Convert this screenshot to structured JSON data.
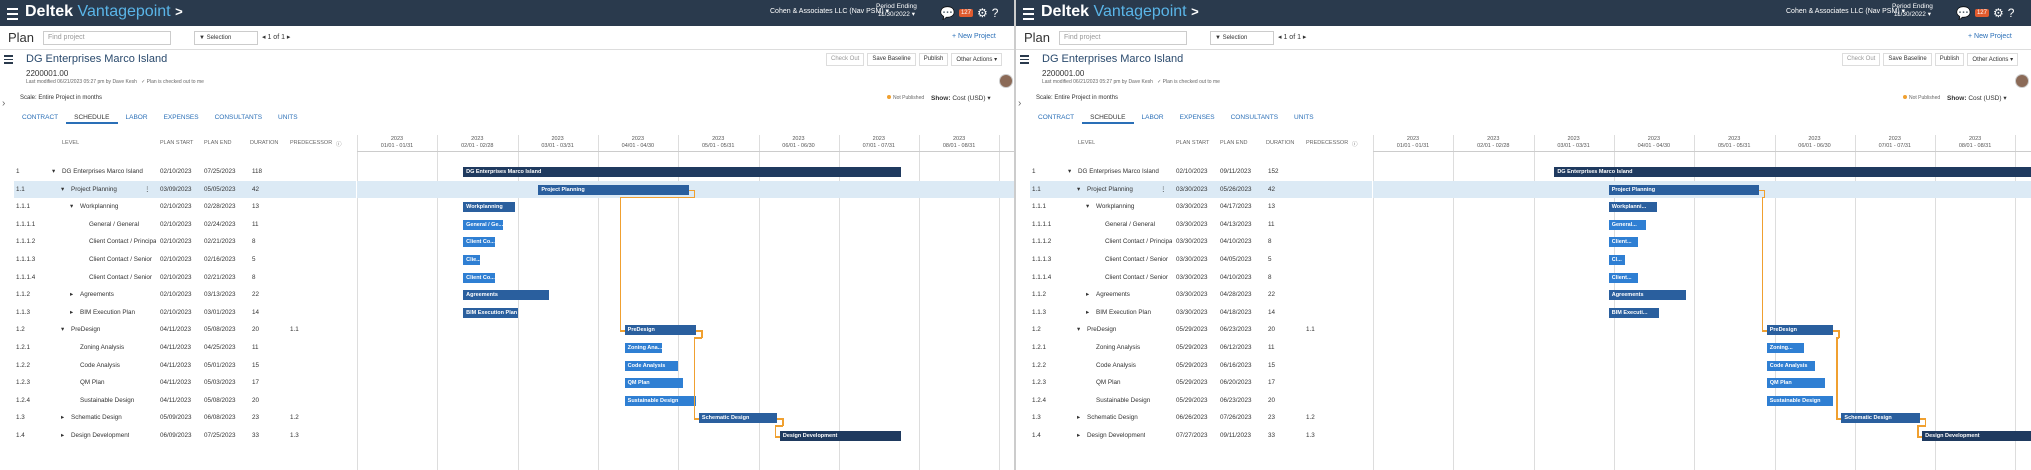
{
  "header": {
    "logo_main": "Deltek",
    "logo_sub": "Vantagepoint",
    "logo_arrow": ">",
    "company": "Cohen & Associates LLC (Nav PSM) ▾",
    "period_label": "Period Ending",
    "period_value": "11/30/2022 ▾",
    "notification_count": "127"
  },
  "toolbar": {
    "plan_label": "Plan",
    "find_placeholder": "Find project",
    "selection_label": "▼ Selection",
    "pager_text": "◂ 1 of 1 ▸",
    "new_project": "+ New Project"
  },
  "project": {
    "title": "DG Enterprises Marco Island",
    "number": "2200001.00",
    "last_modified": "Last modified 06/21/2023 05:27 pm by Dave Kesh",
    "checked_out": "✓ Plan is checked out to me",
    "actions": [
      "Check Out",
      "Save Baseline",
      "Publish",
      "Other Actions ▾"
    ]
  },
  "scale_text": "Scale: Entire Project in months",
  "not_published": "Not Published",
  "show_label": "Show:",
  "show_value": "Cost (USD) ▾",
  "tabs": [
    "CONTRACT",
    "SCHEDULE",
    "LABOR",
    "EXPENSES",
    "CONSULTANTS",
    "UNITS"
  ],
  "columns": [
    "LEVEL",
    "PLAN START",
    "PLAN END",
    "DURATION",
    "PREDECESSOR"
  ],
  "months": [
    [
      "2023",
      "01/01 - 01/31"
    ],
    [
      "2023",
      "02/01 - 02/28"
    ],
    [
      "2023",
      "03/01 - 03/31"
    ],
    [
      "2023",
      "04/01 - 04/30"
    ],
    [
      "2023",
      "05/01 - 05/31"
    ],
    [
      "2023",
      "06/01 - 06/30"
    ],
    [
      "2023",
      "07/01 - 07/31"
    ],
    [
      "2023",
      "08/01 - 08/31"
    ],
    [
      "2023",
      "09/01 - 09/30"
    ],
    [
      "2023",
      "10/01 - 10/31"
    ]
  ],
  "panes": [
    {
      "rows": [
        {
          "lvl": "1",
          "name": "DG Enterprises Marco Island",
          "depth": 0,
          "exp": "▾",
          "start": "02/10/2023",
          "end": "07/25/2023",
          "dur": "118",
          "pred": "",
          "bar": "DG Enterprises Marco Island",
          "bs": "2023-02-10",
          "be": "2023-07-25",
          "color": "dark"
        },
        {
          "lvl": "1.1",
          "name": "Project Planning",
          "depth": 1,
          "exp": "▾",
          "start": "03/09/2023",
          "end": "05/05/2023",
          "dur": "42",
          "pred": "",
          "bar": "Project Planning",
          "bs": "2023-03-09",
          "be": "2023-05-05",
          "color": "mid",
          "hl": true,
          "menu": "⋮"
        },
        {
          "lvl": "1.1.1",
          "name": "Workplanning",
          "depth": 2,
          "exp": "▾",
          "start": "02/10/2023",
          "end": "02/28/2023",
          "dur": "13",
          "pred": "",
          "bar": "Workplanning",
          "bs": "2023-02-10",
          "be": "2023-02-28",
          "color": "mid"
        },
        {
          "lvl": "1.1.1.1",
          "name": "General / General",
          "depth": 3,
          "exp": "",
          "start": "02/10/2023",
          "end": "02/24/2023",
          "dur": "11",
          "pred": "",
          "bar": "General / Ge...",
          "bs": "2023-02-10",
          "be": "2023-02-24",
          "color": "light"
        },
        {
          "lvl": "1.1.1.2",
          "name": "Client Contact / Principal",
          "depth": 3,
          "exp": "",
          "start": "02/10/2023",
          "end": "02/21/2023",
          "dur": "8",
          "pred": "",
          "bar": "Client Co...",
          "bs": "2023-02-10",
          "be": "2023-02-21",
          "color": "light"
        },
        {
          "lvl": "1.1.1.3",
          "name": "Client Contact / Senior",
          "depth": 3,
          "exp": "",
          "start": "02/10/2023",
          "end": "02/16/2023",
          "dur": "5",
          "pred": "",
          "bar": "Clie...",
          "bs": "2023-02-10",
          "be": "2023-02-16",
          "color": "light"
        },
        {
          "lvl": "1.1.1.4",
          "name": "Client Contact / Senior",
          "depth": 3,
          "exp": "",
          "start": "02/10/2023",
          "end": "02/21/2023",
          "dur": "8",
          "pred": "",
          "bar": "Client Co...",
          "bs": "2023-02-10",
          "be": "2023-02-21",
          "color": "light"
        },
        {
          "lvl": "1.1.2",
          "name": "Agreements",
          "depth": 2,
          "exp": "▸",
          "start": "02/10/2023",
          "end": "03/13/2023",
          "dur": "22",
          "pred": "",
          "bar": "Agreements",
          "bs": "2023-02-10",
          "be": "2023-03-13",
          "color": "mid"
        },
        {
          "lvl": "1.1.3",
          "name": "BIM Execution Plan",
          "depth": 2,
          "exp": "▸",
          "start": "02/10/2023",
          "end": "03/01/2023",
          "dur": "14",
          "pred": "",
          "bar": "BIM Execution Plan",
          "bs": "2023-02-10",
          "be": "2023-03-01",
          "color": "mid"
        },
        {
          "lvl": "1.2",
          "name": "PreDesign",
          "depth": 1,
          "exp": "▾",
          "start": "04/11/2023",
          "end": "05/08/2023",
          "dur": "20",
          "pred": "1.1",
          "bar": "PreDesign",
          "bs": "2023-04-11",
          "be": "2023-05-08",
          "color": "mid"
        },
        {
          "lvl": "1.2.1",
          "name": "Zoning Analysis",
          "depth": 2,
          "exp": "",
          "start": "04/11/2023",
          "end": "04/25/2023",
          "dur": "11",
          "pred": "",
          "bar": "Zoning Ana...",
          "bs": "2023-04-11",
          "be": "2023-04-25",
          "color": "light"
        },
        {
          "lvl": "1.2.2",
          "name": "Code Analysis",
          "depth": 2,
          "exp": "",
          "start": "04/11/2023",
          "end": "05/01/2023",
          "dur": "15",
          "pred": "",
          "bar": "Code Analysis",
          "bs": "2023-04-11",
          "be": "2023-05-01",
          "color": "light"
        },
        {
          "lvl": "1.2.3",
          "name": "QM Plan",
          "depth": 2,
          "exp": "",
          "start": "04/11/2023",
          "end": "05/03/2023",
          "dur": "17",
          "pred": "",
          "bar": "QM Plan",
          "bs": "2023-04-11",
          "be": "2023-05-03",
          "color": "light"
        },
        {
          "lvl": "1.2.4",
          "name": "Sustainable Design",
          "depth": 2,
          "exp": "",
          "start": "04/11/2023",
          "end": "05/08/2023",
          "dur": "20",
          "pred": "",
          "bar": "Sustainable Design",
          "bs": "2023-04-11",
          "be": "2023-05-08",
          "color": "light"
        },
        {
          "lvl": "1.3",
          "name": "Schematic Design",
          "depth": 1,
          "exp": "▸",
          "start": "05/09/2023",
          "end": "06/08/2023",
          "dur": "23",
          "pred": "1.2",
          "bar": "Schematic Design",
          "bs": "2023-05-09",
          "be": "2023-06-08",
          "color": "mid"
        },
        {
          "lvl": "1.4",
          "name": "Design Development",
          "depth": 1,
          "exp": "▸",
          "start": "06/09/2023",
          "end": "07/25/2023",
          "dur": "33",
          "pred": "1.3",
          "bar": "Design Development",
          "bs": "2023-06-09",
          "be": "2023-07-25",
          "color": "dark"
        }
      ]
    },
    {
      "rows": [
        {
          "lvl": "1",
          "name": "DG Enterprises Marco Island",
          "depth": 0,
          "exp": "▾",
          "start": "02/10/2023",
          "end": "09/11/2023",
          "dur": "152",
          "pred": "",
          "bar": "DG Enterprises Marco Island",
          "bs": "2023-03-09",
          "be": "2023-09-11",
          "color": "dark"
        },
        {
          "lvl": "1.1",
          "name": "Project Planning",
          "depth": 1,
          "exp": "▾",
          "start": "03/30/2023",
          "end": "05/26/2023",
          "dur": "42",
          "pred": "",
          "bar": "Project Planning",
          "bs": "2023-03-30",
          "be": "2023-05-26",
          "color": "mid",
          "hl": true,
          "menu": "⋮"
        },
        {
          "lvl": "1.1.1",
          "name": "Workplanning",
          "depth": 2,
          "exp": "▾",
          "start": "03/30/2023",
          "end": "04/17/2023",
          "dur": "13",
          "pred": "",
          "bar": "Workplanni...",
          "bs": "2023-03-30",
          "be": "2023-04-17",
          "color": "mid"
        },
        {
          "lvl": "1.1.1.1",
          "name": "General / General",
          "depth": 3,
          "exp": "",
          "start": "03/30/2023",
          "end": "04/13/2023",
          "dur": "11",
          "pred": "",
          "bar": "General...",
          "bs": "2023-03-30",
          "be": "2023-04-13",
          "color": "light"
        },
        {
          "lvl": "1.1.1.2",
          "name": "Client Contact / Principal",
          "depth": 3,
          "exp": "",
          "start": "03/30/2023",
          "end": "04/10/2023",
          "dur": "8",
          "pred": "",
          "bar": "Client...",
          "bs": "2023-03-30",
          "be": "2023-04-10",
          "color": "light"
        },
        {
          "lvl": "1.1.1.3",
          "name": "Client Contact / Senior",
          "depth": 3,
          "exp": "",
          "start": "03/30/2023",
          "end": "04/05/2023",
          "dur": "5",
          "pred": "",
          "bar": "Cl...",
          "bs": "2023-03-30",
          "be": "2023-04-05",
          "color": "light"
        },
        {
          "lvl": "1.1.1.4",
          "name": "Client Contact / Senior",
          "depth": 3,
          "exp": "",
          "start": "03/30/2023",
          "end": "04/10/2023",
          "dur": "8",
          "pred": "",
          "bar": "Client...",
          "bs": "2023-03-30",
          "be": "2023-04-10",
          "color": "light"
        },
        {
          "lvl": "1.1.2",
          "name": "Agreements",
          "depth": 2,
          "exp": "▸",
          "start": "03/30/2023",
          "end": "04/28/2023",
          "dur": "22",
          "pred": "",
          "bar": "Agreements",
          "bs": "2023-03-30",
          "be": "2023-04-28",
          "color": "mid"
        },
        {
          "lvl": "1.1.3",
          "name": "BIM Execution Plan",
          "depth": 2,
          "exp": "▸",
          "start": "03/30/2023",
          "end": "04/18/2023",
          "dur": "14",
          "pred": "",
          "bar": "BIM Executi...",
          "bs": "2023-03-30",
          "be": "2023-04-18",
          "color": "mid"
        },
        {
          "lvl": "1.2",
          "name": "PreDesign",
          "depth": 1,
          "exp": "▾",
          "start": "05/29/2023",
          "end": "06/23/2023",
          "dur": "20",
          "pred": "1.1",
          "bar": "PreDesign",
          "bs": "2023-05-29",
          "be": "2023-06-23",
          "color": "mid"
        },
        {
          "lvl": "1.2.1",
          "name": "Zoning Analysis",
          "depth": 2,
          "exp": "",
          "start": "05/29/2023",
          "end": "06/12/2023",
          "dur": "11",
          "pred": "",
          "bar": "Zoning...",
          "bs": "2023-05-29",
          "be": "2023-06-12",
          "color": "light"
        },
        {
          "lvl": "1.2.2",
          "name": "Code Analysis",
          "depth": 2,
          "exp": "",
          "start": "05/29/2023",
          "end": "06/16/2023",
          "dur": "15",
          "pred": "",
          "bar": "Code Analysis",
          "bs": "2023-05-29",
          "be": "2023-06-16",
          "color": "light"
        },
        {
          "lvl": "1.2.3",
          "name": "QM Plan",
          "depth": 2,
          "exp": "",
          "start": "05/29/2023",
          "end": "06/20/2023",
          "dur": "17",
          "pred": "",
          "bar": "QM Plan",
          "bs": "2023-05-29",
          "be": "2023-06-20",
          "color": "light"
        },
        {
          "lvl": "1.2.4",
          "name": "Sustainable Design",
          "depth": 2,
          "exp": "",
          "start": "05/29/2023",
          "end": "06/23/2023",
          "dur": "20",
          "pred": "",
          "bar": "Sustainable Design",
          "bs": "2023-05-29",
          "be": "2023-06-23",
          "color": "light"
        },
        {
          "lvl": "1.3",
          "name": "Schematic Design",
          "depth": 1,
          "exp": "▸",
          "start": "06/26/2023",
          "end": "07/26/2023",
          "dur": "23",
          "pred": "1.2",
          "bar": "Schematic Design",
          "bs": "2023-06-26",
          "be": "2023-07-26",
          "color": "mid"
        },
        {
          "lvl": "1.4",
          "name": "Design Development",
          "depth": 1,
          "exp": "▸",
          "start": "07/27/2023",
          "end": "09/11/2023",
          "dur": "33",
          "pred": "1.3",
          "bar": "Design Development",
          "bs": "2023-07-27",
          "be": "2023-09-11",
          "color": "dark"
        }
      ]
    }
  ]
}
